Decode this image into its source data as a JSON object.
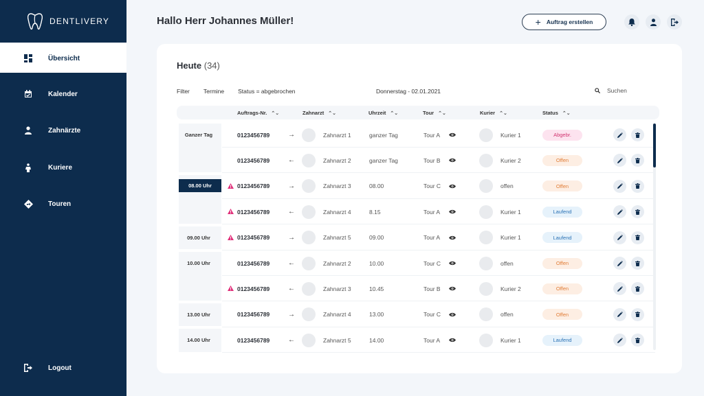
{
  "brand": {
    "name": "DENTLIVERY"
  },
  "nav": {
    "items": [
      {
        "label": "Übersicht",
        "icon": "dashboard-icon",
        "active": true
      },
      {
        "label": "Kalender",
        "icon": "calendar-icon",
        "active": false
      },
      {
        "label": "Zahnärzte",
        "icon": "person-icon",
        "active": false
      },
      {
        "label": "Kuriere",
        "icon": "courier-icon",
        "active": false
      },
      {
        "label": "Touren",
        "icon": "directions-icon",
        "active": false
      }
    ],
    "logout": "Logout"
  },
  "header": {
    "greeting": "Hallo Herr Johannes Müller!",
    "create_label": "Auftrag erstellen"
  },
  "card": {
    "title": "Heute",
    "count": "(34)",
    "filters": [
      "Filter",
      "Termine",
      "Status = abgebrochen"
    ],
    "date": "Donnerstag - 02.01.2021",
    "search_placeholder": "Suchen",
    "columns": [
      "Auftrags-Nr.",
      "Zahnarzt",
      "Uhrzeit",
      "Tour",
      "Kurier",
      "Status"
    ]
  },
  "time_labels": [
    {
      "label": "Ganzer Tag",
      "row": 0,
      "highlight": false
    },
    {
      "label": "08.00 Uhr",
      "row": 2,
      "highlight": true
    },
    {
      "label": "09.00 Uhr",
      "row": 4,
      "highlight": false
    },
    {
      "label": "10.00 Uhr",
      "row": 5,
      "highlight": false
    },
    {
      "label": "13.00 Uhr",
      "row": 7,
      "highlight": false
    },
    {
      "label": "14.00 Uhr",
      "row": 8,
      "highlight": false
    }
  ],
  "rows": [
    {
      "warn": false,
      "order": "0123456789",
      "dir": "→",
      "dentist": "Zahnarzt 1",
      "time": "ganzer Tag",
      "tour": "Tour A",
      "courier": "Kurier 1",
      "status": "Abgebr.",
      "status_type": "abgebr"
    },
    {
      "warn": false,
      "order": "0123456789",
      "dir": "←",
      "dentist": "Zahnarzt 2",
      "time": "ganzer Tag",
      "tour": "Tour B",
      "courier": "Kurier 2",
      "status": "Offen",
      "status_type": "offen"
    },
    {
      "warn": true,
      "order": "0123456789",
      "dir": "→",
      "dentist": "Zahnarzt 3",
      "time": "08.00",
      "tour": "Tour C",
      "courier": "offen",
      "status": "Offen",
      "status_type": "offen"
    },
    {
      "warn": true,
      "order": "0123456789",
      "dir": "←",
      "dentist": "Zahnarzt 4",
      "time": "8.15",
      "tour": "Tour A",
      "courier": "Kurier 1",
      "status": "Laufend",
      "status_type": "laufend"
    },
    {
      "warn": true,
      "order": "0123456789",
      "dir": "→",
      "dentist": "Zahnarzt 5",
      "time": "09.00",
      "tour": "Tour A",
      "courier": "Kurier 1",
      "status": "Laufend",
      "status_type": "laufend"
    },
    {
      "warn": false,
      "order": "0123456789",
      "dir": "←",
      "dentist": "Zahnarzt 2",
      "time": "10.00",
      "tour": "Tour C",
      "courier": "offen",
      "status": "Offen",
      "status_type": "offen"
    },
    {
      "warn": true,
      "order": "0123456789",
      "dir": "←",
      "dentist": "Zahnarzt 3",
      "time": "10.45",
      "tour": "Tour B",
      "courier": "Kurier 2",
      "status": "Offen",
      "status_type": "offen"
    },
    {
      "warn": false,
      "order": "0123456789",
      "dir": "→",
      "dentist": "Zahnarzt 4",
      "time": "13.00",
      "tour": "Tour C",
      "courier": "offen",
      "status": "Offen",
      "status_type": "offen"
    },
    {
      "warn": false,
      "order": "0123456789",
      "dir": "←",
      "dentist": "Zahnarzt 5",
      "time": "14.00",
      "tour": "Tour A",
      "courier": "Kurier 1",
      "status": "Laufend",
      "status_type": "laufend"
    }
  ],
  "colors": {
    "sidebar": "#0d2c4d",
    "warning": "#e0307a",
    "abgebr": "#d1336f",
    "offen": "#e07b34",
    "laufend": "#2a72b5"
  }
}
